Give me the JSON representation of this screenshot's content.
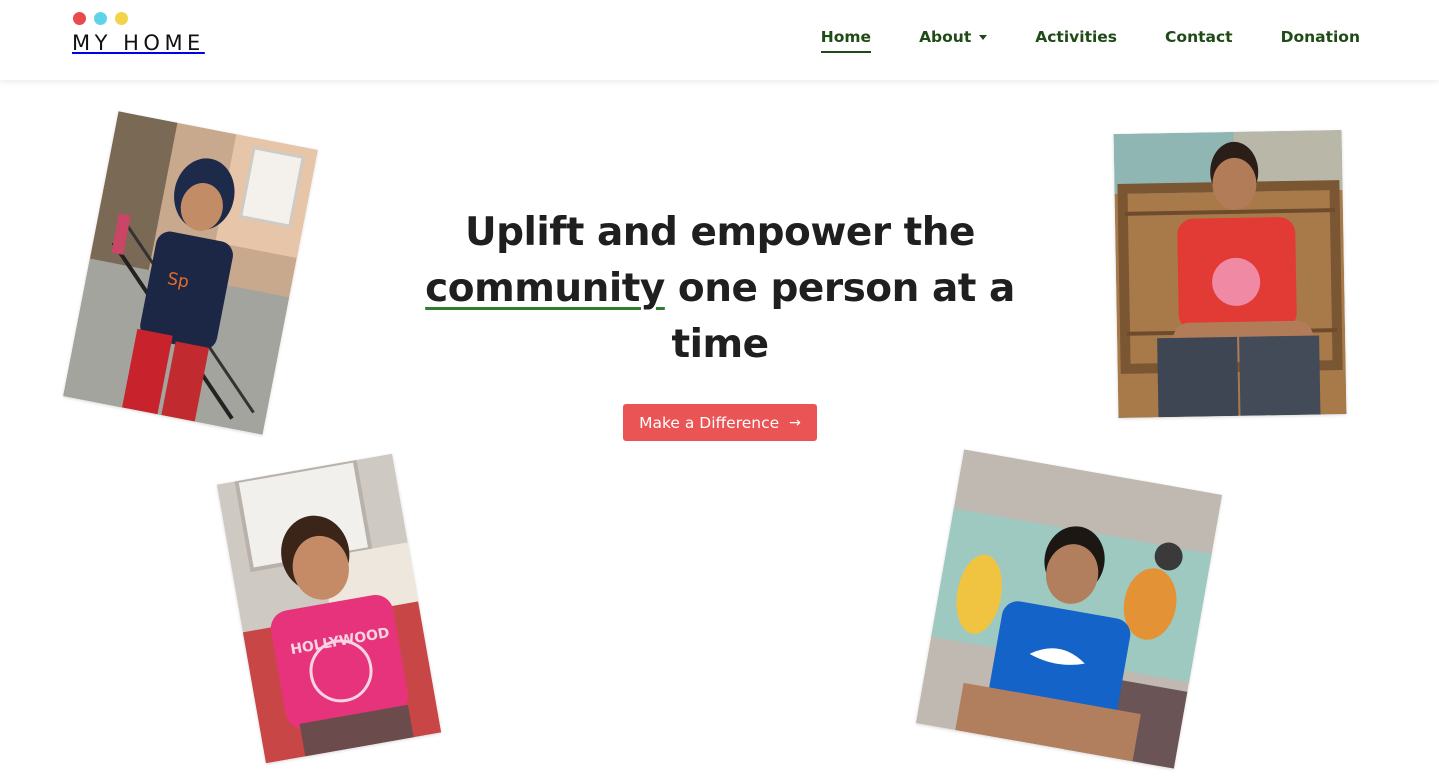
{
  "brand": {
    "name": "MY HOME",
    "dot_colors": [
      "#e94b4b",
      "#5fd4e8",
      "#f3d34a"
    ]
  },
  "nav": {
    "items": [
      {
        "label": "Home",
        "active": true
      },
      {
        "label": "About",
        "dropdown": true
      },
      {
        "label": "Activities"
      },
      {
        "label": "Contact"
      },
      {
        "label": "Donation"
      }
    ]
  },
  "hero": {
    "title_part1": "Uplift and empower the ",
    "title_highlight": "community",
    "title_part2": " one person at a time",
    "cta_label": "Make a Difference",
    "cta_icon": "arrow-right-icon"
  },
  "colors": {
    "nav_text": "#1e4b16",
    "cta_bg": "#ea5455",
    "underline": "#2e7d32"
  },
  "photos": [
    {
      "name": "photo-boy-blue-hoodie"
    },
    {
      "name": "photo-boy-red-shirt"
    },
    {
      "name": "photo-girl-pink-shirt"
    },
    {
      "name": "photo-boy-blue-shirt"
    }
  ]
}
